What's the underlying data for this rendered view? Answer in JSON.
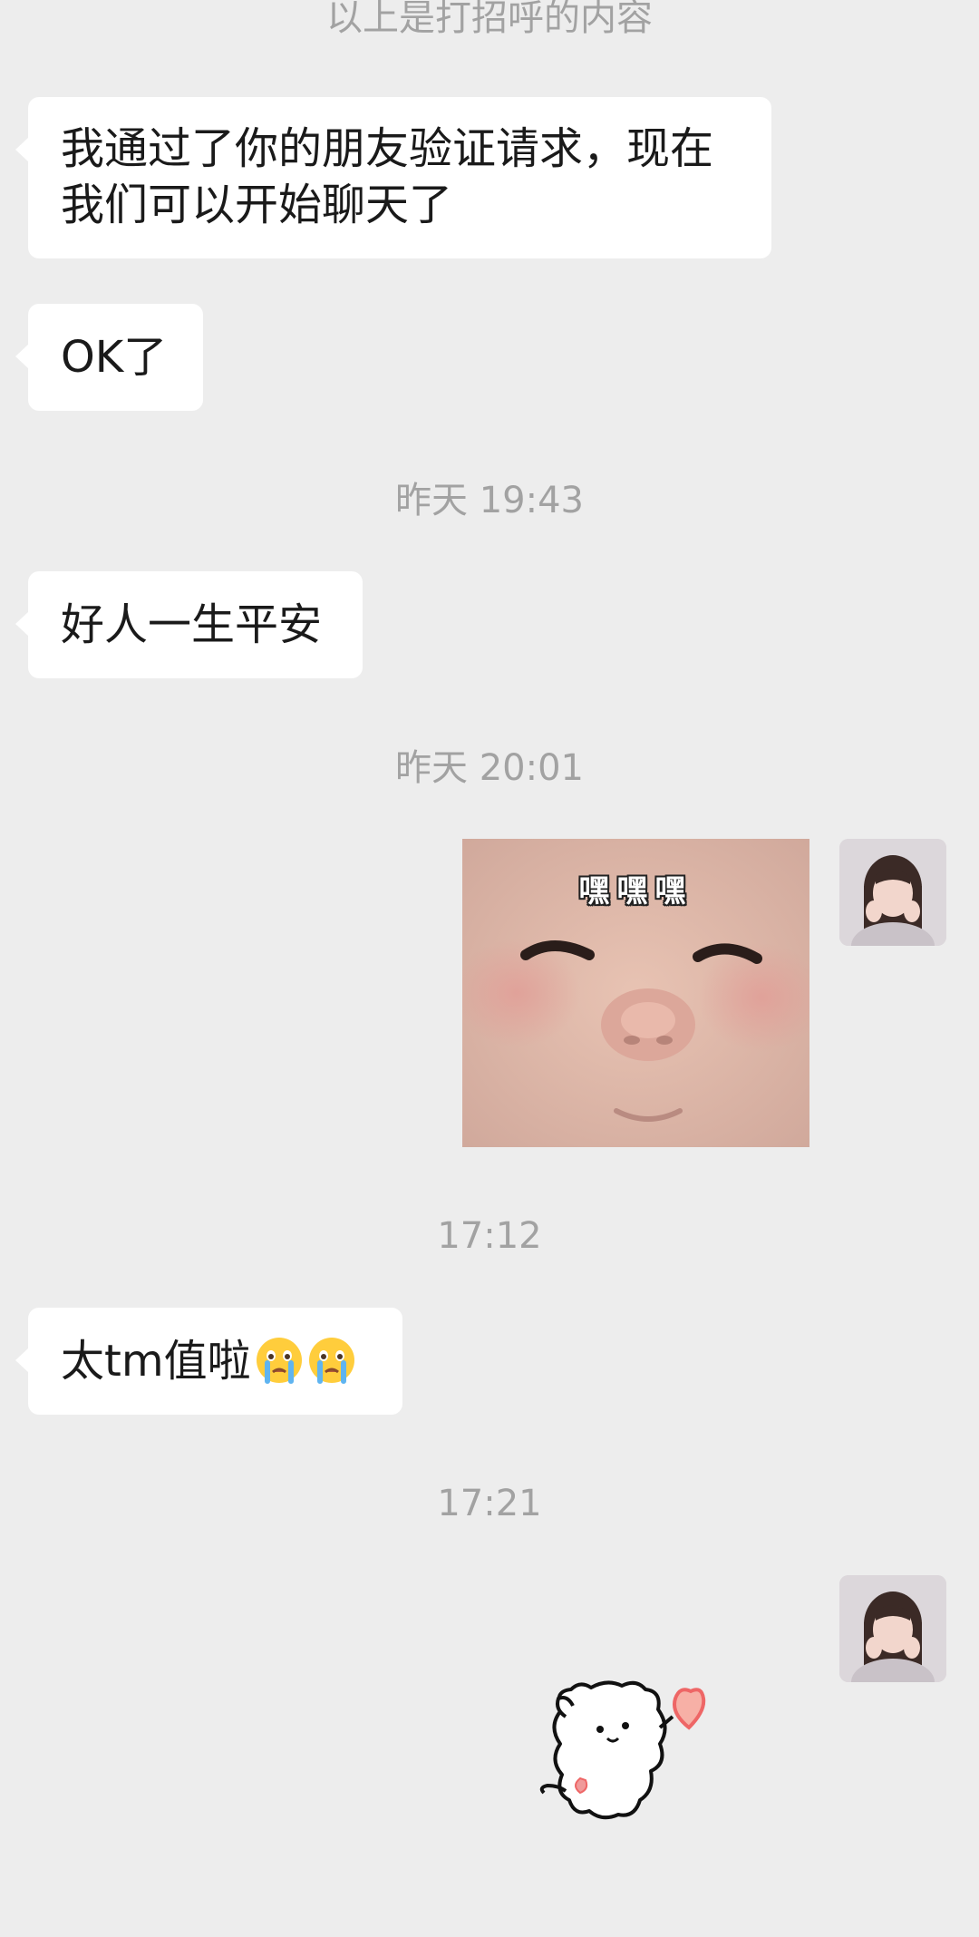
{
  "chat": {
    "greeting_note": "以上是打招呼的内容",
    "messages": {
      "friend_accepted": "我通过了你的朋友验证请求，现在我们可以开始聊天了",
      "ok": "OK了",
      "peace": "好人一生平安",
      "worth_it": "太tm值啦"
    },
    "timestamps": {
      "t1": "昨天 19:43",
      "t2": "昨天 20:01",
      "t3": "17:12",
      "t4": "17:21"
    },
    "sticker": {
      "caption": "嘿嘿嘿"
    },
    "icons": {
      "emoji": "crying-face-icon",
      "avatar": "user-avatar",
      "dog_sticker": "white-dog-heart-sticker"
    }
  }
}
